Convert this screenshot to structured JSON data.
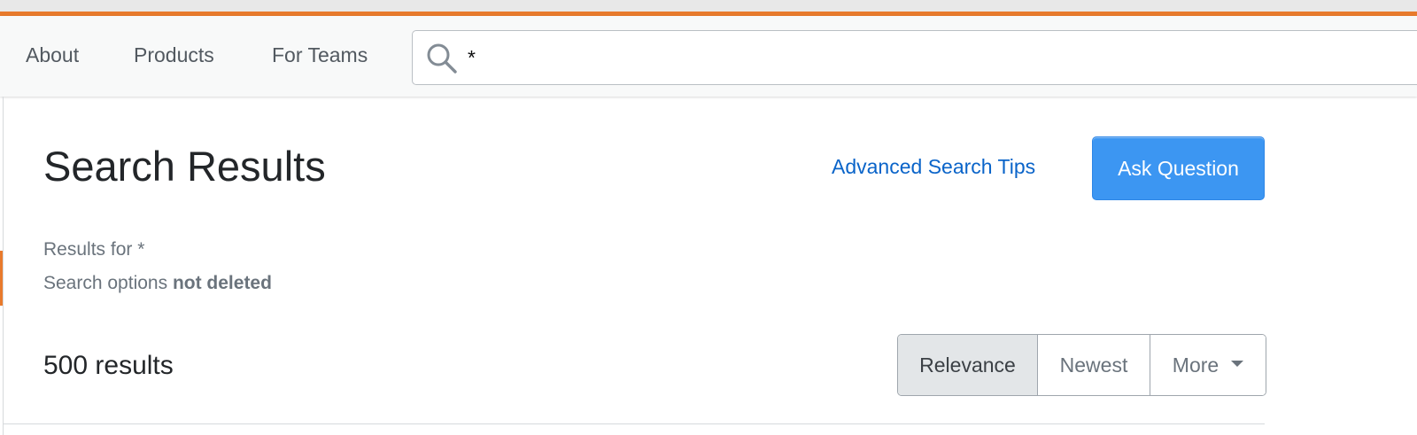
{
  "colors": {
    "accent": "#e87a2c",
    "link": "#0a64c9",
    "primary_button": "#3c96f2"
  },
  "nav": {
    "items": [
      {
        "label": "About"
      },
      {
        "label": "Products"
      },
      {
        "label": "For Teams"
      }
    ]
  },
  "search": {
    "icon": "search-icon",
    "value": "*"
  },
  "header": {
    "title": "Search Results",
    "advanced_link": "Advanced Search Tips",
    "ask_button": "Ask Question"
  },
  "meta": {
    "results_for_prefix": "Results for",
    "query": "*",
    "options_prefix": "Search options",
    "options_value": "not deleted"
  },
  "results": {
    "count_label": "500 results"
  },
  "sort": {
    "selected": "Relevance",
    "options": [
      {
        "label": "Relevance"
      },
      {
        "label": "Newest"
      },
      {
        "label": "More"
      }
    ],
    "more_icon": "caret-down-icon"
  }
}
